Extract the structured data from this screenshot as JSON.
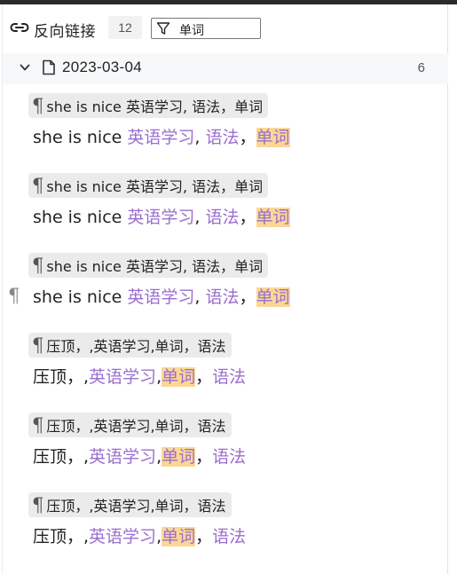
{
  "header": {
    "title": "反向链接",
    "count": "12",
    "filter_value": "单词"
  },
  "group": {
    "date": "2023-03-04",
    "count": "6"
  },
  "items": [
    {
      "chip": "she is nice 英语学习, 语法，单词",
      "para": {
        "text": "she is nice ",
        "t1": "英语学习",
        "s1": ", ",
        "t2": "语法",
        "s2": "，",
        "t3": "单词"
      }
    },
    {
      "chip": "she is nice 英语学习, 语法，单词",
      "para": {
        "text": "she is nice ",
        "t1": "英语学习",
        "s1": ", ",
        "t2": "语法",
        "s2": "，",
        "t3": "单词"
      }
    },
    {
      "chip": "she is nice 英语学习, 语法，单词",
      "para": {
        "text": "she is nice ",
        "t1": "英语学习",
        "s1": ", ",
        "t2": "语法",
        "s2": "，",
        "t3": "单词"
      }
    },
    {
      "chip": "压顶，,英语学习,单词，语法",
      "para": {
        "text": "压顶，,",
        "t1": "英语学习",
        "s1": ",",
        "t2": "单词",
        "s2": "，",
        "t3": "语法"
      }
    },
    {
      "chip": "压顶，,英语学习,单词，语法",
      "para": {
        "text": "压顶，,",
        "t1": "英语学习",
        "s1": ",",
        "t2": "单词",
        "s2": "，",
        "t3": "语法"
      }
    },
    {
      "chip": "压顶，,英语学习,单词，语法",
      "para": {
        "text": "压顶，,",
        "t1": "英语学习",
        "s1": ",",
        "t2": "单词",
        "s2": "，",
        "t3": "语法"
      }
    }
  ],
  "icons": {
    "header": "link-icon",
    "filter": "filter-icon",
    "group_toggle": "chevron-down-icon",
    "group_doc": "document-icon",
    "paragraph": "pilcrow-icon"
  },
  "colors": {
    "tag": "#9a6fcf",
    "highlight": "#fbd796",
    "chip_bg": "#ebebeb"
  }
}
